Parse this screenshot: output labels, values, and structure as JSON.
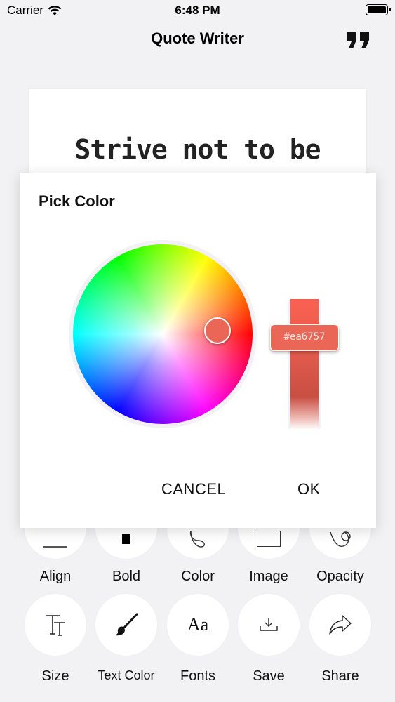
{
  "status_bar": {
    "carrier": "Carrier",
    "time": "6:48 PM"
  },
  "nav": {
    "title": "Quote Writer",
    "quote_icon": "quote-icon"
  },
  "canvas": {
    "text": "Strive not to be"
  },
  "dialog": {
    "title": "Pick Color",
    "selected_color": "#ea6757",
    "hex_label": "#ea6757",
    "cancel_label": "CANCEL",
    "ok_label": "OK"
  },
  "toolbar": {
    "row1": [
      {
        "label": "Align",
        "icon": "align-icon"
      },
      {
        "label": "Bold",
        "icon": "bold-icon"
      },
      {
        "label": "Color",
        "icon": "palette-icon"
      },
      {
        "label": "Image",
        "icon": "image-icon"
      },
      {
        "label": "Opacity",
        "icon": "opacity-icon"
      }
    ],
    "row2": [
      {
        "label": "Size",
        "icon": "text-size-icon"
      },
      {
        "label": "Text Color",
        "icon": "brush-icon"
      },
      {
        "label": "Fonts",
        "icon": "fonts-icon",
        "glyph": "Aa"
      },
      {
        "label": "Save",
        "icon": "download-icon"
      },
      {
        "label": "Share",
        "icon": "share-icon"
      }
    ]
  }
}
